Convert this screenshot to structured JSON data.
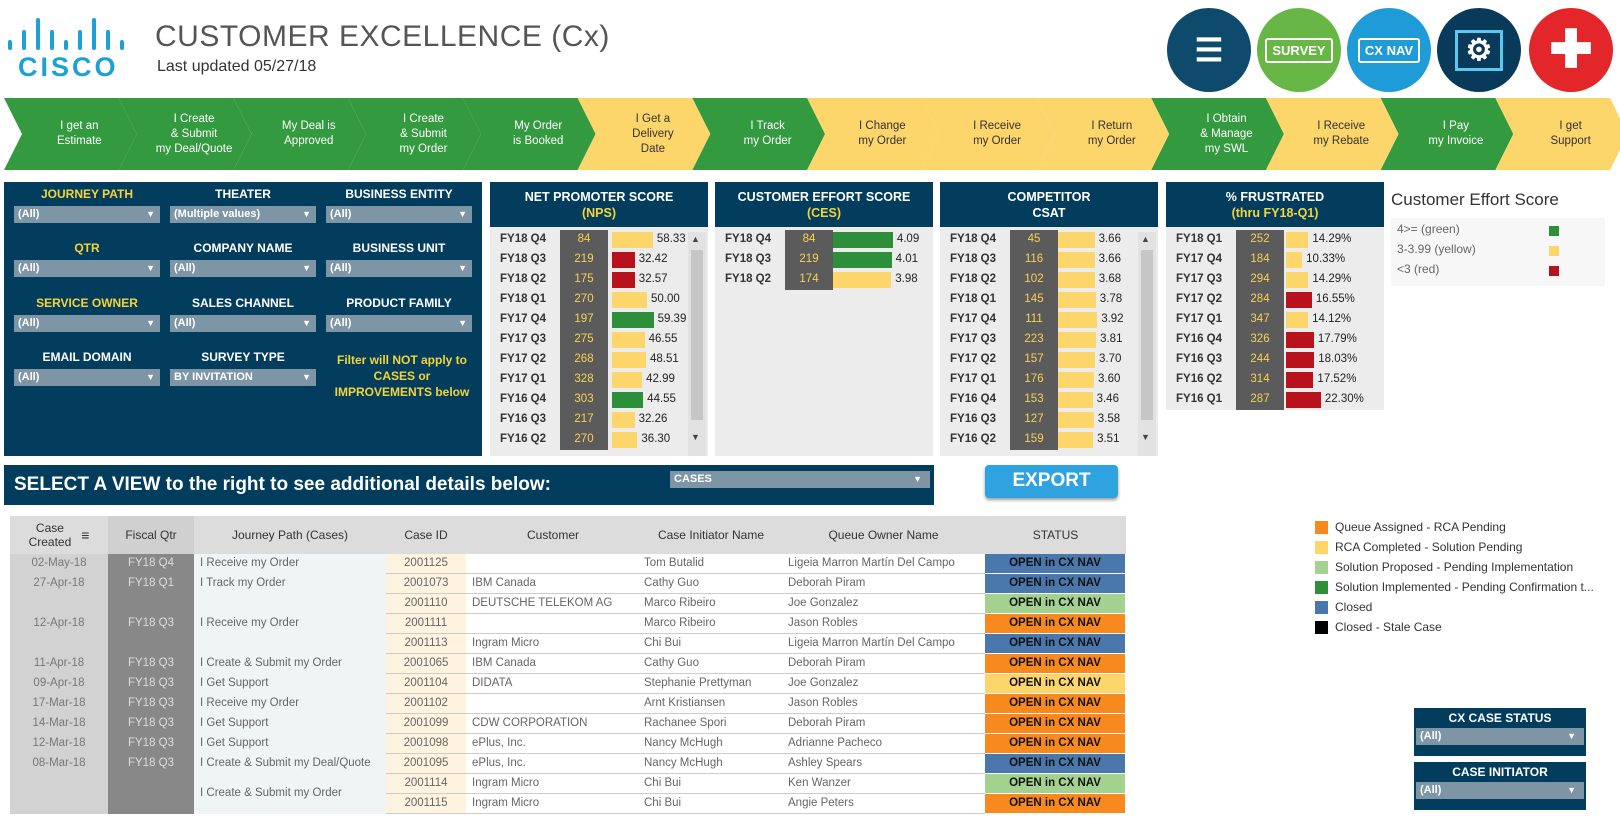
{
  "header": {
    "logo_text": "CISCO",
    "title": "CUSTOMER EXCELLENCE (Cx)",
    "updated": "Last updated 05/27/18",
    "buttons": [
      {
        "label": "",
        "icon": "presenter-icon",
        "color": "#0d4a6b"
      },
      {
        "label": "SURVEY",
        "icon": "survey-envelope-icon",
        "color": "#67b646"
      },
      {
        "label": "CX NAV",
        "icon": "cx-nav-icon",
        "color": "#1f9bd7"
      },
      {
        "label": "",
        "icon": "settings-monitor-icon",
        "color": "#0a3a5a"
      },
      {
        "label": "",
        "icon": "plus-icon",
        "color": "#e2262a"
      }
    ]
  },
  "journey": [
    {
      "label": "I get an\nEstimate",
      "color": "green"
    },
    {
      "label": "I Create\n& Submit\nmy Deal/Quote",
      "color": "green"
    },
    {
      "label": "My Deal is\nApproved",
      "color": "green"
    },
    {
      "label": "I Create\n& Submit\nmy Order",
      "color": "green"
    },
    {
      "label": "My Order\nis Booked",
      "color": "green"
    },
    {
      "label": "I Get a\nDelivery\nDate",
      "color": "yellow"
    },
    {
      "label": "I Track\nmy Order",
      "color": "green"
    },
    {
      "label": "I Change\nmy Order",
      "color": "yellow"
    },
    {
      "label": "I Receive\nmy Order",
      "color": "yellow"
    },
    {
      "label": "I Return\nmy Order",
      "color": "yellow"
    },
    {
      "label": "I Obtain\n& Manage\nmy SWL",
      "color": "green"
    },
    {
      "label": "I Receive\nmy Rebate",
      "color": "yellow"
    },
    {
      "label": "I Pay\nmy Invoice",
      "color": "green"
    },
    {
      "label": "I get\nSupport",
      "color": "yellow"
    }
  ],
  "filters": {
    "journey_path": {
      "label": "JOURNEY PATH",
      "value": "(All)"
    },
    "theater": {
      "label": "THEATER",
      "value": "(Multiple values)"
    },
    "business_entity": {
      "label": "BUSINESS ENTITY",
      "value": "(All)"
    },
    "qtr": {
      "label": "QTR",
      "value": "(All)"
    },
    "company_name": {
      "label": "COMPANY NAME",
      "value": "(All)"
    },
    "business_unit": {
      "label": "BUSINESS UNIT",
      "value": "(All)"
    },
    "service_owner": {
      "label": "SERVICE OWNER",
      "value": "(All)"
    },
    "sales_channel": {
      "label": "SALES CHANNEL",
      "value": "(All)"
    },
    "product_family": {
      "label": "PRODUCT FAMILY",
      "value": "(All)"
    },
    "email_domain": {
      "label": "EMAIL DOMAIN",
      "value": "(All)"
    },
    "survey_type": {
      "label": "SURVEY TYPE",
      "value": "BY INVITATION"
    },
    "note": "Filter will NOT apply to CASES or IMPROVEMENTS below"
  },
  "nps": {
    "title": "NET PROMOTER SCORE",
    "subtitle": "(NPS)",
    "rows": [
      {
        "q": "FY18 Q4",
        "n": "84",
        "v": "58.33",
        "val": 58.33,
        "color": "#fcd56b"
      },
      {
        "q": "FY18 Q3",
        "n": "219",
        "v": "32.42",
        "val": 32.42,
        "color": "#b8121c"
      },
      {
        "q": "FY18 Q2",
        "n": "175",
        "v": "32.57",
        "val": 32.57,
        "color": "#b8121c"
      },
      {
        "q": "FY18 Q1",
        "n": "270",
        "v": "50.00",
        "val": 50.0,
        "color": "#fcd56b"
      },
      {
        "q": "FY17 Q4",
        "n": "197",
        "v": "59.39",
        "val": 59.39,
        "color": "#2e8f3a"
      },
      {
        "q": "FY17 Q3",
        "n": "275",
        "v": "46.55",
        "val": 46.55,
        "color": "#fcd56b"
      },
      {
        "q": "FY17 Q2",
        "n": "268",
        "v": "48.51",
        "val": 48.51,
        "color": "#fcd56b"
      },
      {
        "q": "FY17 Q1",
        "n": "328",
        "v": "42.99",
        "val": 42.99,
        "color": "#fcd56b"
      },
      {
        "q": "FY16 Q4",
        "n": "303",
        "v": "44.55",
        "val": 44.55,
        "color": "#2e8f3a"
      },
      {
        "q": "FY16 Q3",
        "n": "217",
        "v": "32.26",
        "val": 32.26,
        "color": "#fcd56b"
      },
      {
        "q": "FY16 Q2",
        "n": "270",
        "v": "36.30",
        "val": 36.3,
        "color": "#fcd56b"
      }
    ]
  },
  "ces": {
    "title": "CUSTOMER EFFORT SCORE",
    "subtitle": "(CES)",
    "rows": [
      {
        "q": "FY18 Q4",
        "n": "84",
        "v": "4.09",
        "val": 4.09,
        "color": "#2e8f3a"
      },
      {
        "q": "FY18 Q3",
        "n": "219",
        "v": "4.01",
        "val": 4.01,
        "color": "#2e8f3a"
      },
      {
        "q": "FY18 Q2",
        "n": "174",
        "v": "3.98",
        "val": 3.98,
        "color": "#fcd56b"
      }
    ]
  },
  "csat": {
    "title": "COMPETITOR",
    "subtitle": "CSAT",
    "rows": [
      {
        "q": "FY18 Q4",
        "n": "45",
        "v": "3.66",
        "val": 3.66,
        "color": "#fcd56b"
      },
      {
        "q": "FY18 Q3",
        "n": "116",
        "v": "3.66",
        "val": 3.66,
        "color": "#fcd56b"
      },
      {
        "q": "FY18 Q2",
        "n": "102",
        "v": "3.68",
        "val": 3.68,
        "color": "#fcd56b"
      },
      {
        "q": "FY18 Q1",
        "n": "145",
        "v": "3.78",
        "val": 3.78,
        "color": "#fcd56b"
      },
      {
        "q": "FY17 Q4",
        "n": "111",
        "v": "3.92",
        "val": 3.92,
        "color": "#fcd56b"
      },
      {
        "q": "FY17 Q3",
        "n": "223",
        "v": "3.81",
        "val": 3.81,
        "color": "#fcd56b"
      },
      {
        "q": "FY17 Q2",
        "n": "157",
        "v": "3.70",
        "val": 3.7,
        "color": "#fcd56b"
      },
      {
        "q": "FY17 Q1",
        "n": "176",
        "v": "3.60",
        "val": 3.6,
        "color": "#fcd56b"
      },
      {
        "q": "FY16 Q4",
        "n": "153",
        "v": "3.46",
        "val": 3.46,
        "color": "#fcd56b"
      },
      {
        "q": "FY16 Q3",
        "n": "127",
        "v": "3.58",
        "val": 3.58,
        "color": "#fcd56b"
      },
      {
        "q": "FY16 Q2",
        "n": "159",
        "v": "3.51",
        "val": 3.51,
        "color": "#fcd56b"
      }
    ]
  },
  "frustrated": {
    "title": "% FRUSTRATED",
    "subtitle": "(thru FY18-Q1)",
    "rows": [
      {
        "q": "FY18 Q1",
        "n": "252",
        "v": "14.29%",
        "val": 14.29,
        "color": "#fcd56b"
      },
      {
        "q": "FY17 Q4",
        "n": "184",
        "v": "10.33%",
        "val": 10.33,
        "color": "#fcd56b"
      },
      {
        "q": "FY17 Q3",
        "n": "294",
        "v": "14.29%",
        "val": 14.29,
        "color": "#fcd56b"
      },
      {
        "q": "FY17 Q2",
        "n": "284",
        "v": "16.55%",
        "val": 16.55,
        "color": "#b8121c"
      },
      {
        "q": "FY17 Q1",
        "n": "347",
        "v": "14.12%",
        "val": 14.12,
        "color": "#fcd56b"
      },
      {
        "q": "FY16 Q4",
        "n": "326",
        "v": "17.79%",
        "val": 17.79,
        "color": "#b8121c"
      },
      {
        "q": "FY16 Q3",
        "n": "244",
        "v": "18.03%",
        "val": 18.03,
        "color": "#b8121c"
      },
      {
        "q": "FY16 Q2",
        "n": "314",
        "v": "17.52%",
        "val": 17.52,
        "color": "#b8121c"
      },
      {
        "q": "FY16 Q1",
        "n": "287",
        "v": "22.30%",
        "val": 22.3,
        "color": "#b8121c"
      }
    ]
  },
  "ces_legend": {
    "title": "Customer Effort Score",
    "items": [
      {
        "label": "4>= (green)",
        "color": "#2e8f3a"
      },
      {
        "label": "3-3.99 (yellow)",
        "color": "#fcd56b"
      },
      {
        "label": "<3 (red)",
        "color": "#b8121c"
      }
    ]
  },
  "view": {
    "title": "SELECT A VIEW to the right to see additional details below:",
    "selected": "CASES",
    "export_label": "EXPORT"
  },
  "table": {
    "headers": [
      "Case\nCreated",
      "Fiscal  Qtr",
      "Journey Path (Cases)",
      "Case ID",
      "Customer",
      "Case Initiator Name",
      "Queue Owner Name",
      "STATUS"
    ],
    "groups": [
      {
        "date": "02-May-18",
        "qtr": "FY18 Q4",
        "path": "I Receive my Order",
        "rows": [
          [
            "2001125",
            "",
            "Tom Butalid",
            "Ligeia Marron Martín Del Campo",
            "OPEN in CX NAV",
            "#4a78ad"
          ]
        ]
      },
      {
        "date": "27-Apr-18",
        "qtr": "FY18 Q1",
        "path": "I Track my Order",
        "rows": [
          [
            "2001073",
            "IBM Canada",
            "Cathy Guo",
            "Deborah Piram",
            "OPEN in CX NAV",
            "#4a78ad"
          ]
        ]
      },
      {
        "date": "12-Apr-18",
        "qtr": "FY18 Q3",
        "path": "I Receive my Order",
        "rows": [
          [
            "2001110",
            "DEUTSCHE TELEKOM AG",
            "Marco Ribeiro",
            "Joe Gonzalez",
            "OPEN in CX NAV",
            "#a3d18f"
          ],
          [
            "2001111",
            "",
            "Marco Ribeiro",
            "Jason Robles",
            "OPEN in CX NAV",
            "#f7891f"
          ],
          [
            "2001113",
            "Ingram Micro",
            "Chi Bui",
            "Ligeia Marron Martín Del Campo",
            "OPEN in CX NAV",
            "#4a78ad"
          ]
        ]
      },
      {
        "date": "11-Apr-18",
        "qtr": "FY18 Q3",
        "path": "I Create & Submit my Order",
        "rows": [
          [
            "2001065",
            "IBM Canada",
            "Cathy Guo",
            "Deborah Piram",
            "OPEN in CX NAV",
            "#f7891f"
          ]
        ]
      },
      {
        "date": "09-Apr-18",
        "qtr": "FY18 Q3",
        "path": "I Get Support",
        "rows": [
          [
            "2001104",
            "DIDATA",
            "Stephanie Prettyman",
            "Joe Gonzalez",
            "OPEN in CX NAV",
            "#fcd56b"
          ]
        ]
      },
      {
        "date": "17-Mar-18",
        "qtr": "FY18 Q3",
        "path": "I Receive my Order",
        "rows": [
          [
            "2001102",
            "",
            "Arnt Kristiansen",
            "Jason Robles",
            "OPEN in CX NAV",
            "#f7891f"
          ]
        ]
      },
      {
        "date": "14-Mar-18",
        "qtr": "FY18 Q3",
        "path": "I Get Support",
        "rows": [
          [
            "2001099",
            "CDW CORPORATION",
            "Rachanee Spori",
            "Deborah Piram",
            "OPEN in CX NAV",
            "#f7891f"
          ]
        ]
      },
      {
        "date": "12-Mar-18",
        "qtr": "FY18 Q3",
        "path": "I Get Support",
        "rows": [
          [
            "2001098",
            "ePlus, Inc.",
            "Nancy McHugh",
            "Adrianne Pacheco",
            "OPEN in CX NAV",
            "#f7891f"
          ]
        ]
      },
      {
        "date": "08-Mar-18",
        "qtr": "FY18 Q3",
        "path": "I Create & Submit my Deal/Quote",
        "rows": [
          [
            "2001095",
            "ePlus, Inc.",
            "Nancy McHugh",
            "Ashley Spears",
            "OPEN in CX NAV",
            "#4a78ad"
          ]
        ]
      },
      {
        "date": "",
        "qtr": "",
        "path": "I Create & Submit my Order",
        "rows": [
          [
            "2001114",
            "Ingram Micro",
            "Chi Bui",
            "Ken Wanzer",
            "OPEN in CX NAV",
            "#a3d18f"
          ],
          [
            "2001115",
            "Ingram Micro",
            "Chi Bui",
            "Angie Peters",
            "OPEN in CX NAV",
            "#f7891f"
          ]
        ]
      }
    ]
  },
  "status_legend": [
    {
      "label": "Queue Assigned - RCA Pending",
      "color": "#f7891f"
    },
    {
      "label": "RCA Completed - Solution Pending",
      "color": "#fcd56b"
    },
    {
      "label": "Solution Proposed - Pending Implementation",
      "color": "#a3d18f"
    },
    {
      "label": "Solution Implemented - Pending Confirmation t...",
      "color": "#2e8f3a"
    },
    {
      "label": "Closed",
      "color": "#4a78ad"
    },
    {
      "label": "Closed - Stale Case",
      "color": "#000000"
    }
  ],
  "cx_case_status": {
    "label": "CX CASE STATUS",
    "value": "(All)"
  },
  "case_initiator": {
    "label": "CASE INITIATOR",
    "value": "(All)"
  }
}
